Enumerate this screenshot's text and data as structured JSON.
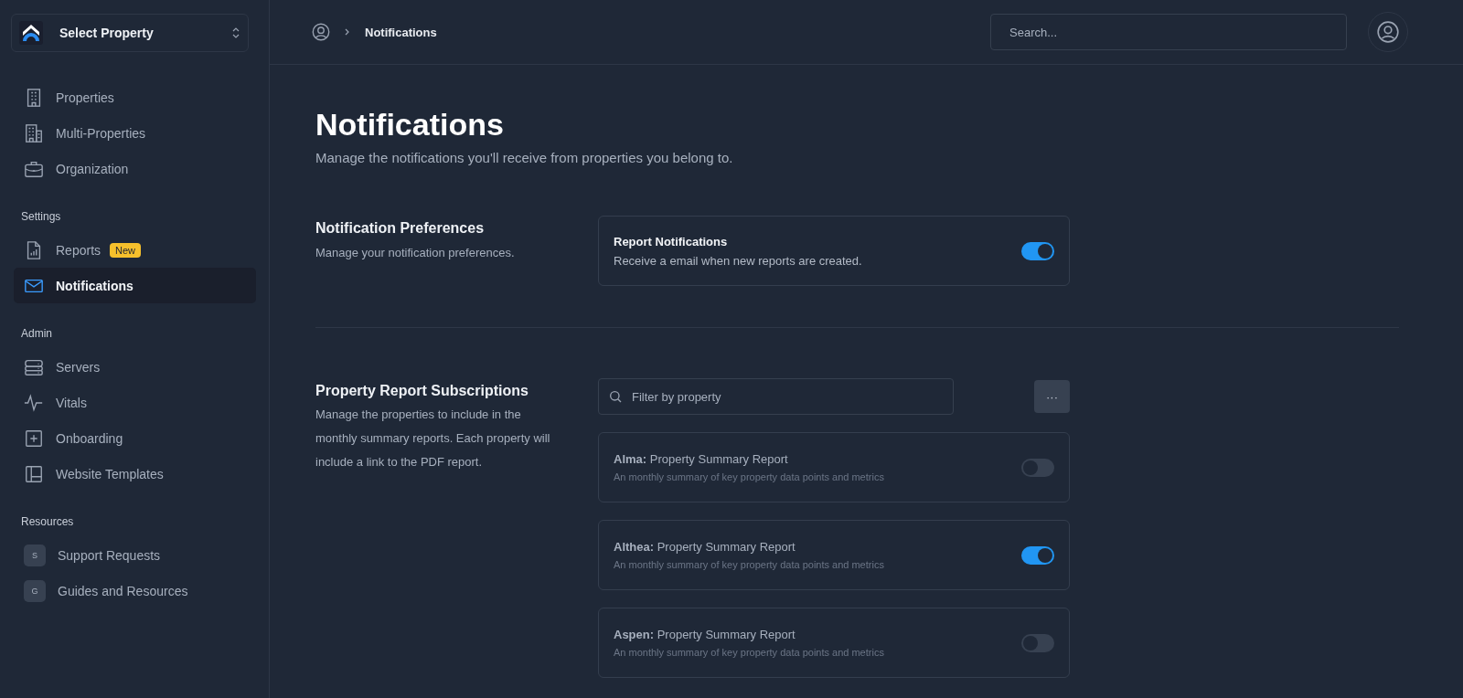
{
  "sidebar": {
    "property_selector": {
      "label": "Select Property"
    },
    "sections": [
      {
        "items": [
          {
            "label": "Properties",
            "selected": false
          },
          {
            "label": "Multi-Properties",
            "selected": false
          },
          {
            "label": "Organization",
            "selected": false
          }
        ]
      },
      {
        "heading": "Settings",
        "items": [
          {
            "label": "Reports",
            "badge": "New",
            "selected": false
          },
          {
            "label": "Notifications",
            "selected": true
          }
        ]
      },
      {
        "heading": "Admin",
        "items": [
          {
            "label": "Servers",
            "selected": false
          },
          {
            "label": "Vitals",
            "selected": false
          },
          {
            "label": "Onboarding",
            "selected": false
          },
          {
            "label": "Website Templates",
            "selected": false
          }
        ]
      },
      {
        "heading": "Resources",
        "items": [
          {
            "label": "Support Requests",
            "initial": "S",
            "selected": false
          },
          {
            "label": "Guides and Resources",
            "initial": "G",
            "selected": false
          }
        ]
      }
    ]
  },
  "header": {
    "breadcrumb": "Notifications",
    "search": {
      "placeholder": "Search..."
    }
  },
  "page": {
    "title": "Notifications",
    "subtitle": "Manage the notifications you'll receive from properties you belong to."
  },
  "preferences": {
    "heading": "Notification Preferences",
    "description": "Manage your notification preferences.",
    "card": {
      "title": "Report Notifications",
      "description": "Receive a email when new reports are created.",
      "on": true
    }
  },
  "subscriptions": {
    "heading": "Property Report Subscriptions",
    "description": "Manage the properties to include in the monthly summary reports. Each property will include a link to the PDF report.",
    "filter": {
      "placeholder": "Filter by property"
    },
    "more_button": "···",
    "items": [
      {
        "title": "**Alma:** Property Summary Report",
        "description": "An monthly summary of key property data points and metrics",
        "on": false
      },
      {
        "title": "**Althea:** Property Summary Report",
        "description": "An monthly summary of key property data points and metrics",
        "on": true
      },
      {
        "title": "**Aspen:** Property Summary Report",
        "description": "An monthly summary of key property data points and metrics",
        "on": false
      }
    ]
  }
}
